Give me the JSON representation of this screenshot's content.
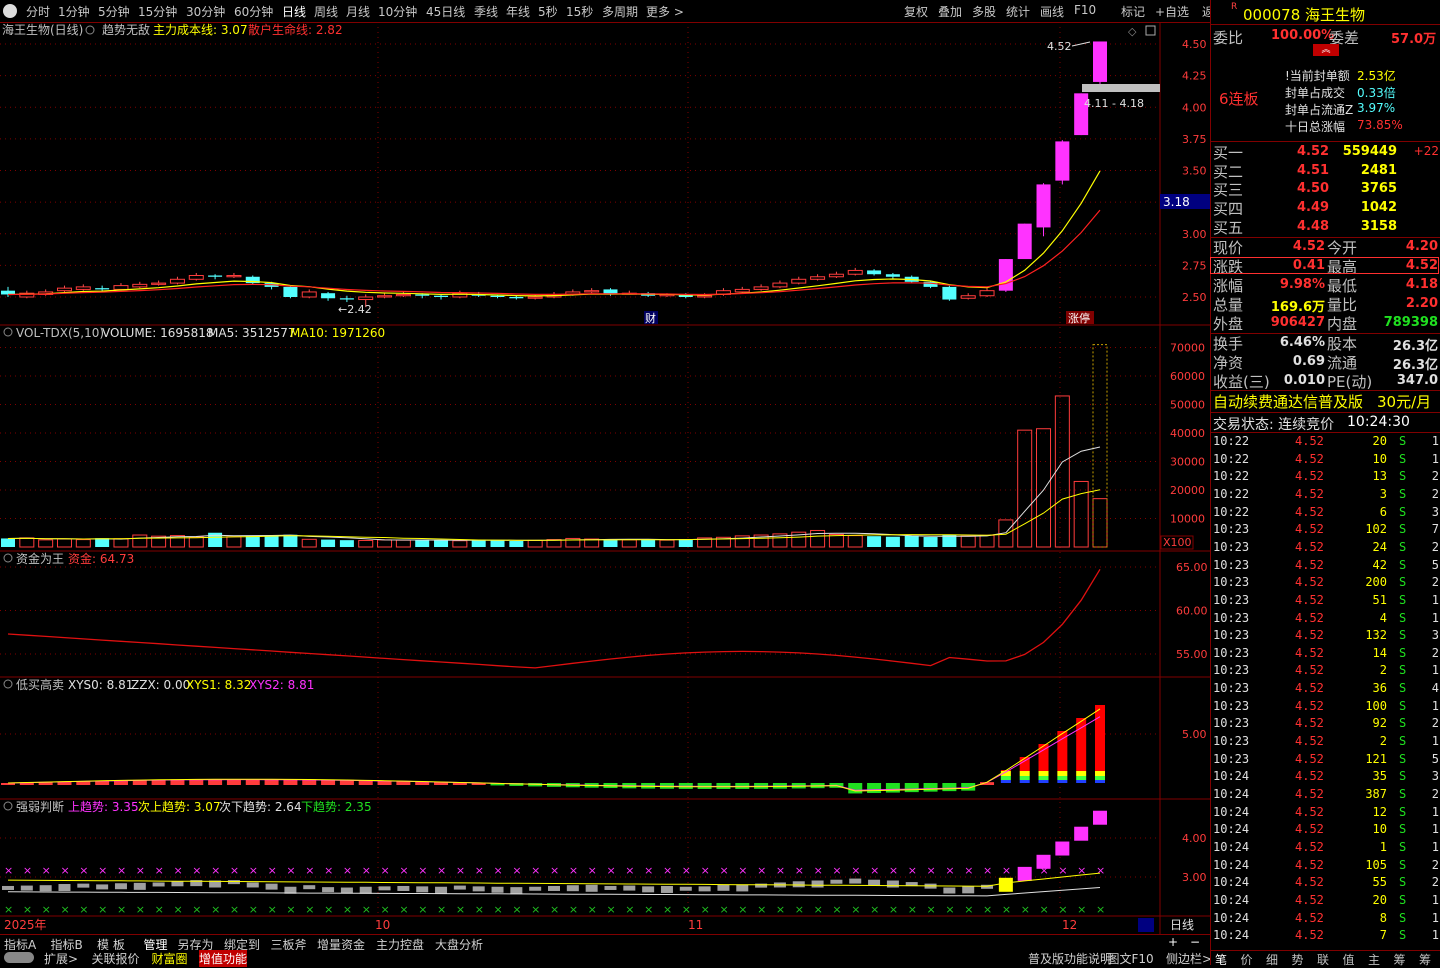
{
  "toolbar": {
    "periods": [
      "分时",
      "1分钟",
      "5分钟",
      "15分钟",
      "30分钟",
      "60分钟",
      "日线",
      "周线",
      "月线",
      "10分钟",
      "45日线",
      "季线",
      "年线",
      "5秒",
      "15秒",
      "多周期",
      "更多 >"
    ],
    "active_period": "日线",
    "tools": [
      "复权",
      "叠加",
      "多股",
      "统计",
      "画线",
      "F10",
      "标记",
      "+自选",
      "返回"
    ]
  },
  "kline_header": {
    "name": "海王生物(日线)",
    "ind": "趋势无敌",
    "l1": "主力成本线:",
    "v1": "3.07",
    "l2": "散户生命线:",
    "v2": "2.82"
  },
  "kline_labels": {
    "high": "4.52",
    "low": "←2.42",
    "range": "4.11 - 4.18",
    "cursor": "3.18",
    "cai": "财",
    "zhangting": "涨停"
  },
  "vol_header": {
    "name": "VOL-TDX(5,10)",
    "vol": "VOLUME: 1695818",
    "ma5": "MA5: 3512577",
    "ma10": "MA10: 1971260"
  },
  "vol_unit": "X100",
  "fund_header": {
    "name": "资金为王",
    "l": "资金:",
    "v": "64.73"
  },
  "dm_header": {
    "name": "低买高卖",
    "a": "XYS0: 8.81",
    "b": "ZZX: 0.00",
    "c": "XYS1: 8.32",
    "d": "XYS2: 8.81"
  },
  "qr_header": {
    "name": "强弱判断",
    "a": "上趋势: 3.35",
    "b": "次上趋势: 3.07",
    "c": "次下趋势: 2.64",
    "d": "下趋势: 2.35"
  },
  "axes": {
    "price": [
      "4.50",
      "4.25",
      "4.00",
      "3.75",
      "3.50",
      "3.25",
      "3.00",
      "2.75",
      "2.50"
    ],
    "vol": [
      "70000",
      "60000",
      "50000",
      "40000",
      "30000",
      "20000",
      "10000"
    ],
    "fund": [
      "65.00",
      "60.00",
      "55.00"
    ],
    "dm": [
      "5.00"
    ],
    "qr": [
      "4.00",
      "3.00"
    ]
  },
  "date_axis": {
    "year": "2025年",
    "m10": "10",
    "m11": "11",
    "m12": "12",
    "period": "日线"
  },
  "bottom_tabs1": [
    "指标A",
    "指标B",
    "模 板",
    "管理",
    "另存为",
    "绑定到",
    "三板斧",
    "增量资金",
    "主力控盘",
    "大盘分析"
  ],
  "bottom_tabs2": [
    "扩展>",
    "关联报价",
    "财富圈",
    "增值功能"
  ],
  "bottom_right": [
    "普及版功能说明",
    "图文F10",
    "侧边栏>>"
  ],
  "stock": {
    "code": "000078",
    "name": "海王生物",
    "prefix": "R"
  },
  "weibi": {
    "l1": "委比",
    "v1": "100.00%",
    "l2": "委差",
    "v2": "57.0万"
  },
  "limit": {
    "streak": "6连板",
    "rows": [
      {
        "l": "!当前封单额",
        "v": "2.53亿"
      },
      {
        "l": "封单占成交",
        "v": "0.33倍"
      },
      {
        "l": "封单占流通Z",
        "v": "3.97%"
      },
      {
        "l": "十日总涨幅",
        "v": "73.85%"
      }
    ]
  },
  "bids": [
    {
      "l": "买一",
      "p": "4.52",
      "v": "559449",
      "c": "+22"
    },
    {
      "l": "买二",
      "p": "4.51",
      "v": "2481",
      "c": ""
    },
    {
      "l": "买三",
      "p": "4.50",
      "v": "3765",
      "c": ""
    },
    {
      "l": "买四",
      "p": "4.49",
      "v": "1042",
      "c": ""
    },
    {
      "l": "买五",
      "p": "4.48",
      "v": "3158",
      "c": ""
    }
  ],
  "quote": [
    {
      "l1": "现价",
      "v1": "4.52",
      "l2": "今开",
      "v2": "4.20"
    },
    {
      "l1": "涨跌",
      "v1": "0.41",
      "l2": "最高",
      "v2": "4.52"
    },
    {
      "l1": "涨幅",
      "v1": "9.98%",
      "l2": "最低",
      "v2": "4.18"
    },
    {
      "l1": "总量",
      "v1": "169.6万",
      "l2": "量比",
      "v2": "2.20"
    },
    {
      "l1": "外盘",
      "v1": "906427",
      "l2": "内盘",
      "v2": "789398"
    }
  ],
  "quote2": [
    {
      "l1": "换手",
      "v1": "6.46%",
      "l2": "股本",
      "v2": "26.3亿"
    },
    {
      "l1": "净资",
      "v1": "0.69",
      "l2": "流通",
      "v2": "26.3亿"
    },
    {
      "l1": "收益(三)",
      "v1": "0.010",
      "l2": "PE(动)",
      "v2": "347.0"
    }
  ],
  "promo": {
    "text": "自动续费通达信普及版",
    "price": "30元/月"
  },
  "trade_state": {
    "label": "交易状态: 连续竞价",
    "time": "10:24:30"
  },
  "ticks": [
    [
      "10:22",
      "4.52",
      "20",
      "S",
      "1"
    ],
    [
      "10:22",
      "4.52",
      "10",
      "S",
      "1"
    ],
    [
      "10:22",
      "4.52",
      "13",
      "S",
      "2"
    ],
    [
      "10:22",
      "4.52",
      "3",
      "S",
      "2"
    ],
    [
      "10:22",
      "4.52",
      "6",
      "S",
      "3"
    ],
    [
      "10:23",
      "4.52",
      "102",
      "S",
      "7"
    ],
    [
      "10:23",
      "4.52",
      "24",
      "S",
      "2"
    ],
    [
      "10:23",
      "4.52",
      "42",
      "S",
      "5"
    ],
    [
      "10:23",
      "4.52",
      "200",
      "S",
      "2"
    ],
    [
      "10:23",
      "4.52",
      "51",
      "S",
      "1"
    ],
    [
      "10:23",
      "4.52",
      "4",
      "S",
      "1"
    ],
    [
      "10:23",
      "4.52",
      "132",
      "S",
      "3"
    ],
    [
      "10:23",
      "4.52",
      "14",
      "S",
      "2"
    ],
    [
      "10:23",
      "4.52",
      "2",
      "S",
      "1"
    ],
    [
      "10:23",
      "4.52",
      "36",
      "S",
      "4"
    ],
    [
      "10:23",
      "4.52",
      "100",
      "S",
      "1"
    ],
    [
      "10:23",
      "4.52",
      "92",
      "S",
      "2"
    ],
    [
      "10:23",
      "4.52",
      "2",
      "S",
      "1"
    ],
    [
      "10:23",
      "4.52",
      "121",
      "S",
      "5"
    ],
    [
      "10:24",
      "4.52",
      "35",
      "S",
      "3"
    ],
    [
      "10:24",
      "4.52",
      "387",
      "S",
      "2"
    ],
    [
      "10:24",
      "4.52",
      "12",
      "S",
      "1"
    ],
    [
      "10:24",
      "4.52",
      "10",
      "S",
      "1"
    ],
    [
      "10:24",
      "4.52",
      "1",
      "S",
      "1"
    ],
    [
      "10:24",
      "4.52",
      "105",
      "S",
      "2"
    ],
    [
      "10:24",
      "4.52",
      "55",
      "S",
      "2"
    ],
    [
      "10:24",
      "4.52",
      "20",
      "S",
      "1"
    ],
    [
      "10:24",
      "4.52",
      "8",
      "S",
      "1"
    ],
    [
      "10:24",
      "4.52",
      "7",
      "S",
      "1"
    ]
  ],
  "rp_tabs": [
    "笔",
    "价",
    "细",
    "势",
    "联",
    "值",
    "主",
    "筹",
    "筹"
  ],
  "chart_data": {
    "type": "candlestick",
    "title": "海王生物(日线)",
    "candles": [
      [
        2.55,
        2.52,
        2.58,
        2.5
      ],
      [
        2.5,
        2.53,
        2.55,
        2.49
      ],
      [
        2.52,
        2.54,
        2.56,
        2.51
      ],
      [
        2.55,
        2.57,
        2.59,
        2.54
      ],
      [
        2.56,
        2.58,
        2.6,
        2.55
      ],
      [
        2.57,
        2.56,
        2.59,
        2.54
      ],
      [
        2.56,
        2.59,
        2.61,
        2.55
      ],
      [
        2.58,
        2.6,
        2.62,
        2.57
      ],
      [
        2.6,
        2.61,
        2.63,
        2.59
      ],
      [
        2.61,
        2.64,
        2.66,
        2.6
      ],
      [
        2.64,
        2.67,
        2.69,
        2.63
      ],
      [
        2.67,
        2.66,
        2.68,
        2.64
      ],
      [
        2.66,
        2.67,
        2.69,
        2.65
      ],
      [
        2.66,
        2.61,
        2.67,
        2.6
      ],
      [
        2.61,
        2.58,
        2.62,
        2.56
      ],
      [
        2.58,
        2.5,
        2.59,
        2.49
      ],
      [
        2.5,
        2.54,
        2.56,
        2.49
      ],
      [
        2.53,
        2.49,
        2.54,
        2.47
      ],
      [
        2.49,
        2.48,
        2.51,
        2.46
      ],
      [
        2.48,
        2.5,
        2.52,
        2.42
      ],
      [
        2.5,
        2.51,
        2.53,
        2.49
      ],
      [
        2.51,
        2.52,
        2.54,
        2.5
      ],
      [
        2.52,
        2.51,
        2.53,
        2.49
      ],
      [
        2.51,
        2.5,
        2.52,
        2.48
      ],
      [
        2.5,
        2.53,
        2.55,
        2.49
      ],
      [
        2.52,
        2.51,
        2.54,
        2.5
      ],
      [
        2.51,
        2.5,
        2.52,
        2.49
      ],
      [
        2.5,
        2.49,
        2.51,
        2.48
      ],
      [
        2.49,
        2.5,
        2.52,
        2.48
      ],
      [
        2.5,
        2.52,
        2.54,
        2.49
      ],
      [
        2.52,
        2.54,
        2.56,
        2.51
      ],
      [
        2.54,
        2.55,
        2.57,
        2.53
      ],
      [
        2.56,
        2.52,
        2.57,
        2.51
      ],
      [
        2.53,
        2.53,
        2.55,
        2.52
      ],
      [
        2.53,
        2.51,
        2.54,
        2.5
      ],
      [
        2.51,
        2.52,
        2.53,
        2.5
      ],
      [
        2.52,
        2.5,
        2.53,
        2.49
      ],
      [
        2.5,
        2.51,
        2.53,
        2.49
      ],
      [
        2.52,
        2.55,
        2.57,
        2.51
      ],
      [
        2.54,
        2.56,
        2.58,
        2.53
      ],
      [
        2.56,
        2.58,
        2.6,
        2.55
      ],
      [
        2.58,
        2.61,
        2.63,
        2.57
      ],
      [
        2.61,
        2.64,
        2.66,
        2.6
      ],
      [
        2.64,
        2.66,
        2.68,
        2.63
      ],
      [
        2.66,
        2.68,
        2.7,
        2.65
      ],
      [
        2.68,
        2.71,
        2.73,
        2.67
      ],
      [
        2.71,
        2.68,
        2.72,
        2.67
      ],
      [
        2.68,
        2.66,
        2.69,
        2.64
      ],
      [
        2.66,
        2.62,
        2.67,
        2.61
      ],
      [
        2.62,
        2.58,
        2.63,
        2.57
      ],
      [
        2.58,
        2.48,
        2.59,
        2.47
      ],
      [
        2.49,
        2.51,
        2.53,
        2.48
      ],
      [
        2.51,
        2.55,
        2.57,
        2.5
      ],
      [
        2.55,
        2.8,
        2.8,
        2.54
      ],
      [
        2.8,
        3.08,
        3.08,
        2.94
      ],
      [
        3.05,
        3.39,
        3.4,
        2.98
      ],
      [
        3.42,
        3.73,
        3.74,
        3.39
      ],
      [
        3.78,
        4.11,
        4.11,
        3.78
      ],
      [
        4.2,
        4.52,
        4.52,
        4.18
      ]
    ],
    "volume": [
      3000,
      3200,
      2500,
      2800,
      2600,
      3100,
      2900,
      4200,
      3800,
      4000,
      3500,
      5000,
      3600,
      3900,
      4100,
      4300,
      2700,
      2600,
      2400,
      2300,
      2500,
      2400,
      2600,
      2300,
      2200,
      2500,
      2400,
      2100,
      2300,
      2600,
      3000,
      2800,
      2700,
      2500,
      2600,
      2400,
      2800,
      3200,
      3400,
      3900,
      4200,
      4600,
      5200,
      5800,
      4400,
      4000,
      3800,
      3600,
      3900,
      3500,
      4200,
      3800,
      4100,
      9500,
      41000,
      41500,
      53000,
      23000,
      16958
    ],
    "ma_main_last": 3.07,
    "ma_retail_last": 2.82,
    "fund_last": 64.73
  }
}
